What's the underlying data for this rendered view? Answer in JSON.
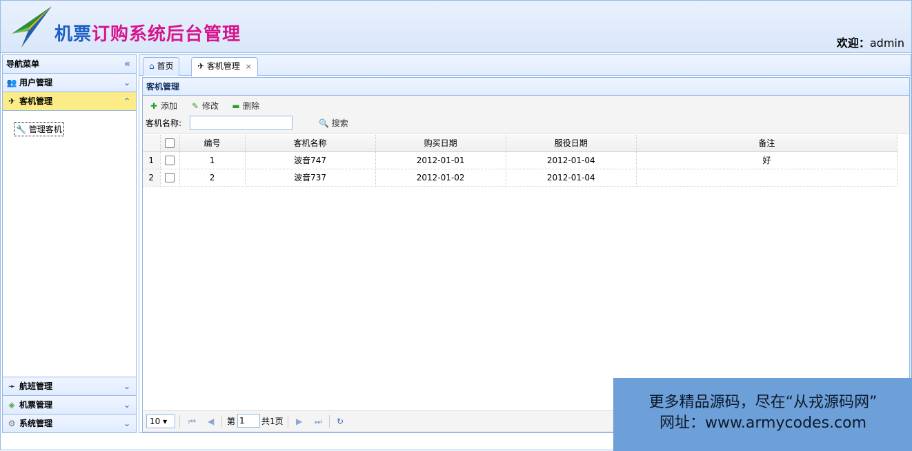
{
  "header": {
    "title_part1": "机票",
    "title_part2": "订购系统后台管理",
    "welcome_label": "欢迎：",
    "username": "admin"
  },
  "sidebar": {
    "title": "导航菜单",
    "groups": [
      {
        "label": "用户管理",
        "icon": "users-icon"
      },
      {
        "label": "客机管理",
        "icon": "plane-icon"
      },
      {
        "label": "航班管理",
        "icon": "flight-icon"
      },
      {
        "label": "机票管理",
        "icon": "ticket-icon"
      },
      {
        "label": "系统管理",
        "icon": "gear-icon"
      }
    ],
    "active_item": "管理客机"
  },
  "tabs": [
    {
      "label": "首页"
    },
    {
      "label": "客机管理",
      "close": "×"
    }
  ],
  "panel": {
    "title": "客机管理",
    "toolbar": {
      "add": "添加",
      "edit": "修改",
      "delete": "删除"
    },
    "search": {
      "label": "客机名称:",
      "button": "搜索",
      "value": ""
    }
  },
  "grid": {
    "columns": [
      "编号",
      "客机名称",
      "购买日期",
      "服役日期",
      "备注"
    ],
    "rows": [
      {
        "rn": "1",
        "id": "1",
        "name": "波音747",
        "buy": "2012-01-01",
        "serve": "2012-01-04",
        "note": "好"
      },
      {
        "rn": "2",
        "id": "2",
        "name": "波音737",
        "buy": "2012-01-02",
        "serve": "2012-01-04",
        "note": ""
      }
    ]
  },
  "pager": {
    "page_size": "10",
    "page_prefix": "第",
    "page_value": "1",
    "page_total": "共1页"
  },
  "watermark": {
    "line1": "更多精品源码，尽在“从戎源码网”",
    "line2": "网址：www.armycodes.com"
  }
}
